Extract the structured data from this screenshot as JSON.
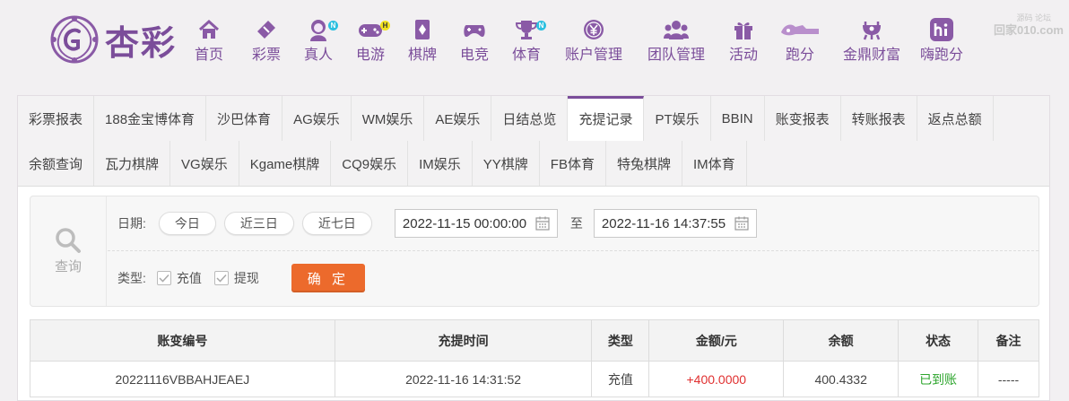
{
  "logo": {
    "text": "杏彩"
  },
  "nav": [
    {
      "label": "首页",
      "icon": "home-icon",
      "badge": ""
    },
    {
      "label": "彩票",
      "icon": "lottery-ticket-icon",
      "badge": ""
    },
    {
      "label": "真人",
      "icon": "live-dealer-icon",
      "badge": "N"
    },
    {
      "label": "电游",
      "icon": "gamepad-icon",
      "badge": "H"
    },
    {
      "label": "棋牌",
      "icon": "cards-icon",
      "badge": ""
    },
    {
      "label": "电竞",
      "icon": "esports-controller-icon",
      "badge": ""
    },
    {
      "label": "体育",
      "icon": "trophy-icon",
      "badge": "N"
    },
    {
      "label": "账户管理",
      "icon": "account-coin-icon",
      "badge": ""
    },
    {
      "label": "团队管理",
      "icon": "team-icon",
      "badge": ""
    },
    {
      "label": "活动",
      "icon": "gift-icon",
      "badge": ""
    },
    {
      "label": "跑分",
      "icon": "running-score-icon",
      "badge": ""
    },
    {
      "label": "金鼎财富",
      "icon": "golden-cauldron-icon",
      "badge": ""
    },
    {
      "label": "嗨跑分",
      "icon": "hi-app-icon",
      "badge": ""
    }
  ],
  "watermark": {
    "small": "源码 论坛",
    "main": "回家010.com"
  },
  "tabs_row1": [
    "彩票报表",
    "188金宝博体育",
    "沙巴体育",
    "AG娱乐",
    "WM娱乐",
    "AE娱乐",
    "日结总览",
    "充提记录",
    "PT娱乐",
    "BBIN",
    "账变报表",
    "转账报表",
    "返点总额"
  ],
  "tabs_row2": [
    "余额查询",
    "瓦力棋牌",
    "VG娱乐",
    "Kgame棋牌",
    "CQ9娱乐",
    "IM娱乐",
    "YY棋牌",
    "FB体育",
    "特兔棋牌",
    "IM体育"
  ],
  "active_tab": "充提记录",
  "query": {
    "side_label": "查询",
    "date_label": "日期:",
    "quick_dates": [
      "今日",
      "近三日",
      "近七日"
    ],
    "start": "2022-11-15 00:00:00",
    "to_label": "至",
    "end": "2022-11-16 14:37:55",
    "type_label": "类型:",
    "types": [
      {
        "label": "充值",
        "checked": true
      },
      {
        "label": "提现",
        "checked": true
      }
    ],
    "confirm": "确 定"
  },
  "table": {
    "headers": [
      "账变编号",
      "充提时间",
      "类型",
      "金额/元",
      "余额",
      "状态",
      "备注"
    ],
    "rows": [
      [
        "20221116VBBAHJEAEJ",
        "2022-11-16 14:31:52",
        "充值",
        "+400.0000",
        "400.4332",
        "已到账",
        "-----"
      ]
    ]
  },
  "colors": {
    "brand": "#7b4d9a",
    "accent_button": "#ec6a2c",
    "amount": "#e03030",
    "status_ok": "#2da52d",
    "badge_new": "#2cc0e0",
    "badge_hot": "#f2e11e"
  }
}
